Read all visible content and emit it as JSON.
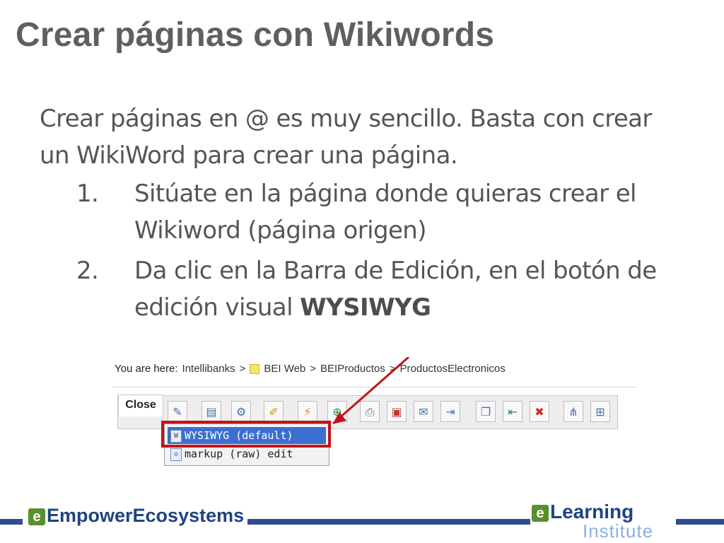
{
  "slide": {
    "title": "Crear páginas con Wikiwords",
    "intro": "Crear páginas en @ es muy sencillo. Basta con crear un WikiWord para crear una página.",
    "steps": [
      {
        "num": "1.",
        "text": "Sitúate en la página donde quieras crear el Wikiword (página origen)"
      },
      {
        "num": "2.",
        "text_plain": "Da clic en la Barra de Edición, en el botón de edición visual ",
        "text_bold": "WYSIWYG"
      }
    ]
  },
  "screenshot": {
    "breadcrumb": {
      "prefix": "You are here:",
      "items": [
        "Intellibanks",
        "BEI Web",
        "BEIProductos",
        "ProductosElectronicos"
      ],
      "separator": ">"
    },
    "close_tab": "Close",
    "dropdown": {
      "items": [
        "WYSIWYG (default)",
        "markup (raw) edit"
      ],
      "selected": "WYSIWYG (default)"
    },
    "toolbar_icons": [
      "edit-icon",
      "page-icon",
      "tools-icon",
      "edit-page-icon",
      "broom-icon",
      "add-icon",
      "print-icon",
      "pdf-icon",
      "email-icon",
      "export-icon",
      "copy-icon",
      "import-icon",
      "delete-icon",
      "tree-icon",
      "new-page-icon"
    ],
    "highlight_color": "#c0141b"
  },
  "footer": {
    "left_logo": {
      "e": "e",
      "word1": "Empower",
      "word2": "Ecosystems"
    },
    "right_logo": {
      "e": "e",
      "word1": "Learning",
      "word2": "Institute"
    },
    "bar_color": "#2f4d8c"
  }
}
